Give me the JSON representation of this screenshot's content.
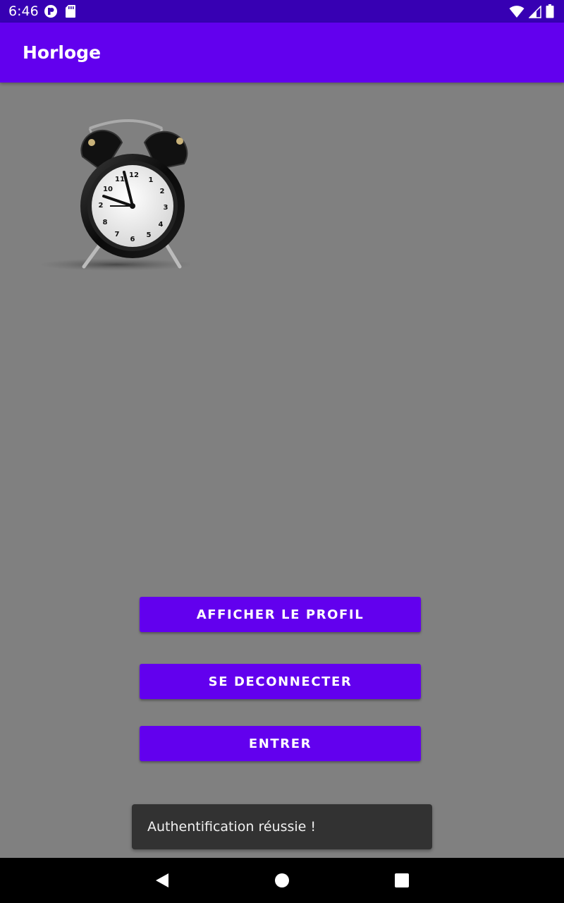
{
  "status_bar": {
    "time": "6:46",
    "left_icons": [
      "app-notification-icon",
      "sd-card-icon"
    ],
    "right_icons": [
      "wifi-icon",
      "cellular-signal-icon",
      "battery-icon"
    ]
  },
  "app_bar": {
    "title": "Horloge"
  },
  "main": {
    "image": "alarm-clock-image",
    "buttons": [
      {
        "label": "AFFICHER LE PROFIL"
      },
      {
        "label": "SE DECONNECTER"
      },
      {
        "label": "ENTRER"
      }
    ]
  },
  "toast": {
    "message": "Authentification réussie !"
  },
  "nav_bar": {
    "icons": [
      "back-icon",
      "home-icon",
      "recents-icon"
    ]
  },
  "colors": {
    "status_bar": "#3700b3",
    "primary": "#6200ee",
    "background": "#808080",
    "toast": "#323232"
  }
}
